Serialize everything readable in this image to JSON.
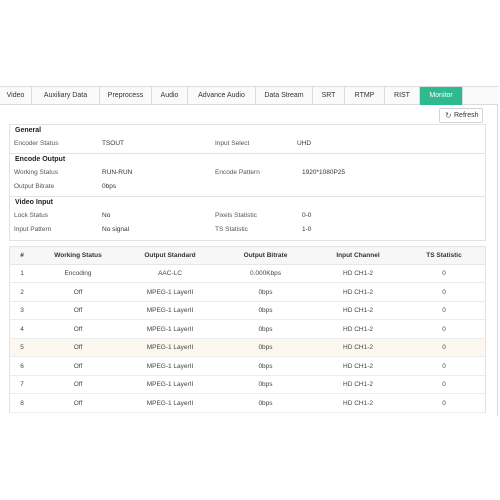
{
  "tabs": [
    {
      "label": "Video"
    },
    {
      "label": "Auxiliary Data"
    },
    {
      "label": "Preprocess"
    },
    {
      "label": "Audio"
    },
    {
      "label": "Advance Audio"
    },
    {
      "label": "Data Stream"
    },
    {
      "label": "SRT"
    },
    {
      "label": "RTMP"
    },
    {
      "label": "RIST"
    },
    {
      "label": "Monitor"
    }
  ],
  "active_tab": "Monitor",
  "accent_color": "#2fb98f",
  "refresh": {
    "icon": "refresh-icon",
    "label": "Refresh"
  },
  "general": {
    "title": "General",
    "encoder_status_label": "Encoder Status",
    "encoder_status_value": "TSOUT",
    "input_select_label": "Input Select",
    "input_select_value": "UHD"
  },
  "encode_output": {
    "title": "Encode Output",
    "working_status_label": "Working Status",
    "working_status_value": "RUN-RUN",
    "encode_pattern_label": "Encode Pattern",
    "encode_pattern_value": "1920*1080P25",
    "output_bitrate_label": "Output Bitrate",
    "output_bitrate_value": "0bps"
  },
  "video_input": {
    "title": "Video Input",
    "lock_status_label": "Lock Status",
    "lock_status_value": "No",
    "pixels_statistic_label": "Pixels Statistic",
    "pixels_statistic_value": "0-0",
    "input_pattern_label": "Input Pattern",
    "input_pattern_value": "No signal",
    "ts_statistic_label": "TS Statistic",
    "ts_statistic_value": "1-0"
  },
  "table": {
    "headers": [
      "#",
      "Working Status",
      "Output Standard",
      "Output Bitrate",
      "Input Channel",
      "TS Statistic"
    ],
    "rows": [
      [
        "1",
        "Encoding",
        "AAC-LC",
        "0.000Kbps",
        "HD CH1-2",
        "0"
      ],
      [
        "2",
        "Off",
        "MPEG-1 LayerII",
        "0bps",
        "HD CH1-2",
        "0"
      ],
      [
        "3",
        "Off",
        "MPEG-1 LayerII",
        "0bps",
        "HD CH1-2",
        "0"
      ],
      [
        "4",
        "Off",
        "MPEG-1 LayerII",
        "0bps",
        "HD CH1-2",
        "0"
      ],
      [
        "5",
        "Off",
        "MPEG-1 LayerII",
        "0bps",
        "HD CH1-2",
        "0"
      ],
      [
        "6",
        "Off",
        "MPEG-1 LayerII",
        "0bps",
        "HD CH1-2",
        "0"
      ],
      [
        "7",
        "Off",
        "MPEG-1 LayerII",
        "0bps",
        "HD CH1-2",
        "0"
      ],
      [
        "8",
        "Off",
        "MPEG-1 LayerII",
        "0bps",
        "HD CH1-2",
        "0"
      ]
    ],
    "highlighted_row": 5
  }
}
